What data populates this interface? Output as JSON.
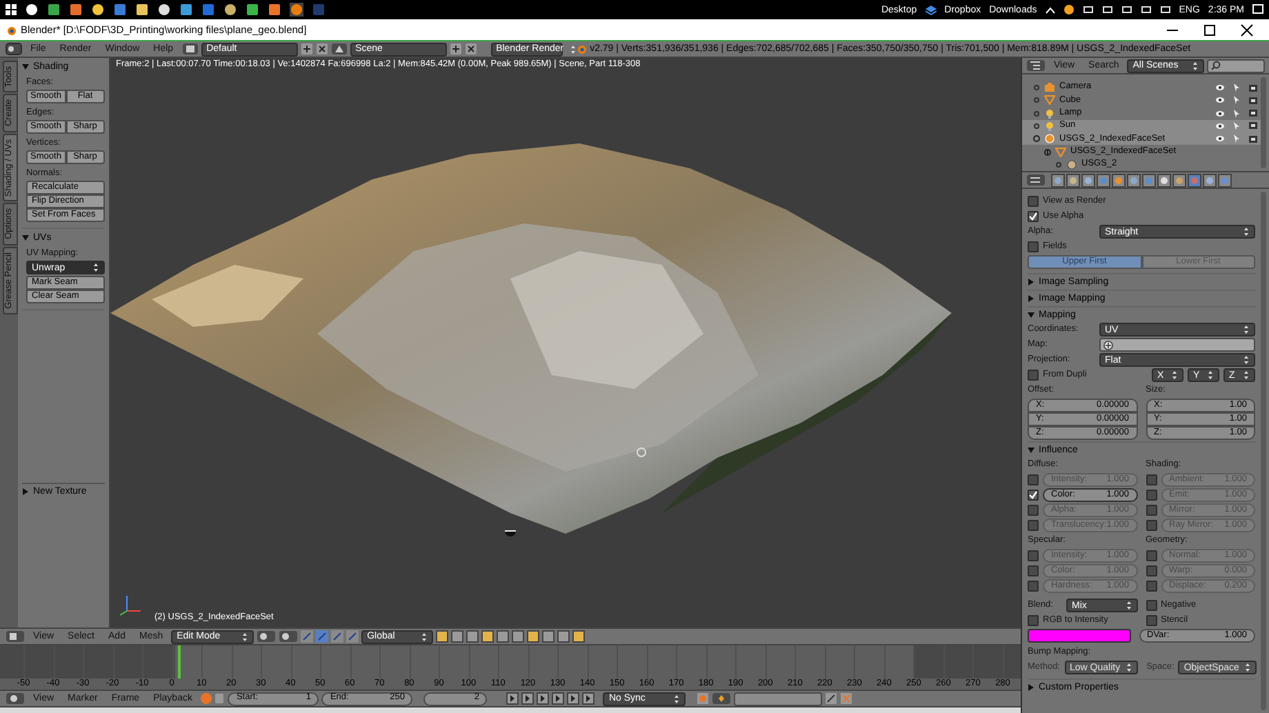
{
  "taskbar": {
    "tray": [
      "Desktop",
      "Dropbox",
      "Downloads",
      "ENG"
    ],
    "time": "2:36 PM"
  },
  "window": {
    "title": "Blender* [D:\\FODF\\3D_Printing\\working files\\plane_geo.blend]"
  },
  "info_header": {
    "menus": [
      "File",
      "Render",
      "Window",
      "Help"
    ],
    "layout": "Default",
    "scene": "Scene",
    "engine": "Blender Render",
    "stats": "v2.79 | Verts:351,936/351,936 | Edges:702,685/702,685 | Faces:350,750/350,750 | Tris:701,500 | Mem:818.89M | USGS_2_IndexedFaceSet"
  },
  "tool_shelf": {
    "tabs": [
      {
        "label": "Tools",
        "selected": false
      },
      {
        "label": "Create",
        "selected": false
      },
      {
        "label": "Shading / UVs",
        "selected": true
      },
      {
        "label": "Options",
        "selected": false
      },
      {
        "label": "Grease Pencil",
        "selected": false
      }
    ],
    "panels": [
      {
        "title": "Shading",
        "expanded": true,
        "rows": [
          {
            "kind": "label",
            "text": "Faces:"
          },
          {
            "kind": "row",
            "buttons": [
              "Smooth",
              "Flat"
            ]
          },
          {
            "kind": "label",
            "text": "Edges:"
          },
          {
            "kind": "row",
            "buttons": [
              "Smooth",
              "Sharp"
            ]
          },
          {
            "kind": "label",
            "text": "Vertices:"
          },
          {
            "kind": "row",
            "buttons": [
              "Smooth",
              "Sharp"
            ]
          },
          {
            "kind": "label",
            "text": "Normals:"
          },
          {
            "kind": "column",
            "buttons": [
              "Recalculate",
              "Flip Direction",
              "Set From Faces"
            ]
          }
        ]
      },
      {
        "title": "UVs",
        "expanded": true,
        "rows": [
          {
            "kind": "label",
            "text": "UV Mapping:"
          },
          {
            "kind": "menu",
            "text": "Unwrap"
          },
          {
            "kind": "column",
            "buttons": [
              "Mark Seam",
              "Clear Seam"
            ]
          }
        ]
      }
    ],
    "last_operator": {
      "title": "New Texture",
      "expanded": false
    }
  },
  "viewport": {
    "info": "Frame:2 | Last:00:07.70 Time:00:18.03 | Ve:1402874 Fa:696998 La:2 | Mem:845.42M (0.00M, Peak 989.65M) | Scene, Part 118-308",
    "object_label": "(2) USGS_2_IndexedFaceSet"
  },
  "view3d_header": {
    "menus": [
      "View",
      "Select",
      "Add",
      "Mesh"
    ],
    "mode": "Edit Mode",
    "orientation": "Global"
  },
  "timeline": {
    "ticks": [
      "-50",
      "-40",
      "-30",
      "-20",
      "-10",
      "0",
      "10",
      "20",
      "30",
      "40",
      "50",
      "60",
      "70",
      "80",
      "90",
      "100",
      "110",
      "120",
      "130",
      "140",
      "150",
      "160",
      "170",
      "180",
      "190",
      "200",
      "210",
      "220",
      "230",
      "240",
      "250",
      "260",
      "270",
      "280"
    ]
  },
  "timeline_header": {
    "menus": [
      "View",
      "Marker",
      "Frame",
      "Playback"
    ],
    "start_label": "Start:",
    "start": "1",
    "end_label": "End:",
    "end": "250",
    "current_frame": "2",
    "sync": "No Sync"
  },
  "outliner": {
    "menus": [
      "View",
      "Search"
    ],
    "filter": "All Scenes",
    "items": [
      {
        "name": "Camera",
        "kind": "camera",
        "selected": false
      },
      {
        "name": "Cube",
        "kind": "mesh",
        "selected": false
      },
      {
        "name": "Lamp",
        "kind": "lamp",
        "selected": false
      },
      {
        "name": "Sun",
        "kind": "lamp",
        "selected": true
      },
      {
        "name": "USGS_2_IndexedFaceSet",
        "kind": "object",
        "selected": true,
        "expanded": true,
        "children": [
          {
            "name": "USGS_2_IndexedFaceSet",
            "kind": "mesh",
            "selected": false,
            "children": [
              {
                "name": "USGS_2",
                "kind": "material",
                "selected": false
              }
            ]
          }
        ]
      }
    ]
  },
  "properties": {
    "tabs": [
      {
        "selected": false
      },
      {
        "selected": false
      },
      {
        "selected": false
      },
      {
        "selected": false
      },
      {
        "selected": false
      },
      {
        "selected": false
      },
      {
        "selected": false
      },
      {
        "selected": false
      },
      {
        "selected": false
      },
      {
        "selected": true
      },
      {
        "selected": false
      },
      {
        "selected": false
      }
    ],
    "rows": [
      {
        "kind": "checkbox",
        "label": "View as Render",
        "checked": false
      },
      {
        "kind": "checkbox",
        "label": "Use Alpha",
        "checked": true
      },
      {
        "kind": "select",
        "label": "Alpha:",
        "value": "Straight"
      },
      {
        "kind": "checkbox",
        "label": "Fields",
        "checked": false
      },
      {
        "kind": "toggle",
        "options": [
          {
            "label": "Upper First",
            "selected": true
          },
          {
            "label": "Lower First",
            "selected": false
          }
        ]
      },
      {
        "kind": "panel",
        "title": "Image Sampling",
        "expanded": false
      },
      {
        "kind": "panel",
        "title": "Image Mapping",
        "expanded": false
      },
      {
        "kind": "panel",
        "title": "Mapping",
        "expanded": true
      },
      {
        "kind": "select",
        "label": "Coordinates:",
        "value": "UV"
      },
      {
        "kind": "field",
        "label": "Map:"
      },
      {
        "kind": "select",
        "label": "Projection:",
        "value": "Flat"
      },
      {
        "kind": "dupli",
        "label": "From Dupli",
        "checked": false,
        "axes": [
          "X",
          "Y",
          "Z"
        ]
      },
      {
        "kind": "vectors",
        "groups": [
          {
            "label": "Offset:",
            "fields": [
              {
                "axis": "X:",
                "value": "0.00000"
              },
              {
                "axis": "Y:",
                "value": "0.00000"
              },
              {
                "axis": "Z:",
                "value": "0.00000"
              }
            ]
          },
          {
            "label": "Size:",
            "fields": [
              {
                "axis": "X:",
                "value": "1.00"
              },
              {
                "axis": "Y:",
                "value": "1.00"
              },
              {
                "axis": "Z:",
                "value": "1.00"
              }
            ]
          }
        ]
      },
      {
        "kind": "panel",
        "title": "Influence",
        "expanded": true
      },
      {
        "kind": "factors",
        "groups": [
          {
            "label": "Diffuse:",
            "fields": [
              {
                "label": "Intensity:",
                "value": "1.000",
                "checked": false
              },
              {
                "label": "Color:",
                "value": "1.000",
                "checked": true
              },
              {
                "label": "Alpha:",
                "value": "1.000",
                "checked": false
              },
              {
                "label": "Translucency:",
                "value": "1.000",
                "checked": false
              }
            ]
          },
          {
            "label": "Shading:",
            "fields": [
              {
                "label": "Ambient:",
                "value": "1.000",
                "checked": false
              },
              {
                "label": "Emit:",
                "value": "1.000",
                "checked": false
              },
              {
                "label": "Mirror:",
                "value": "1.000",
                "checked": false
              },
              {
                "label": "Ray Mirror:",
                "value": "1.000",
                "checked": false
              }
            ]
          }
        ]
      },
      {
        "kind": "factors",
        "groups": [
          {
            "label": "Specular:",
            "fields": [
              {
                "label": "Intensity:",
                "value": "1.000",
                "checked": false
              },
              {
                "label": "Color:",
                "value": "1.000",
                "checked": false
              },
              {
                "label": "Hardness:",
                "value": "1.000",
                "checked": false
              }
            ]
          },
          {
            "label": "Geometry:",
            "fields": [
              {
                "label": "Normal:",
                "value": "1.000",
                "checked": false
              },
              {
                "label": "Warp:",
                "value": "0.000",
                "checked": false
              },
              {
                "label": "Displace:",
                "value": "0.200",
                "checked": false
              }
            ]
          }
        ]
      },
      {
        "kind": "blend",
        "label": "Blend:",
        "value": "Mix",
        "check": {
          "label": "Negative",
          "checked": false
        }
      },
      {
        "kind": "checkpair",
        "items": [
          {
            "label": "RGB to Intensity",
            "checked": false
          },
          {
            "label": "Stencil",
            "checked": false
          }
        ]
      },
      {
        "kind": "colorrow",
        "color": "#ff00ff",
        "label": "DVar:",
        "value": "1.000"
      },
      {
        "kind": "label",
        "text": "Bump Mapping:"
      },
      {
        "kind": "bump",
        "items": [
          {
            "label": "Method:",
            "value": "Low Quality",
            "disabled": true
          },
          {
            "label": "Space:",
            "value": "ObjectSpace",
            "disabled": true
          }
        ]
      },
      {
        "kind": "panel",
        "title": "Custom Properties",
        "expanded": false
      }
    ]
  }
}
